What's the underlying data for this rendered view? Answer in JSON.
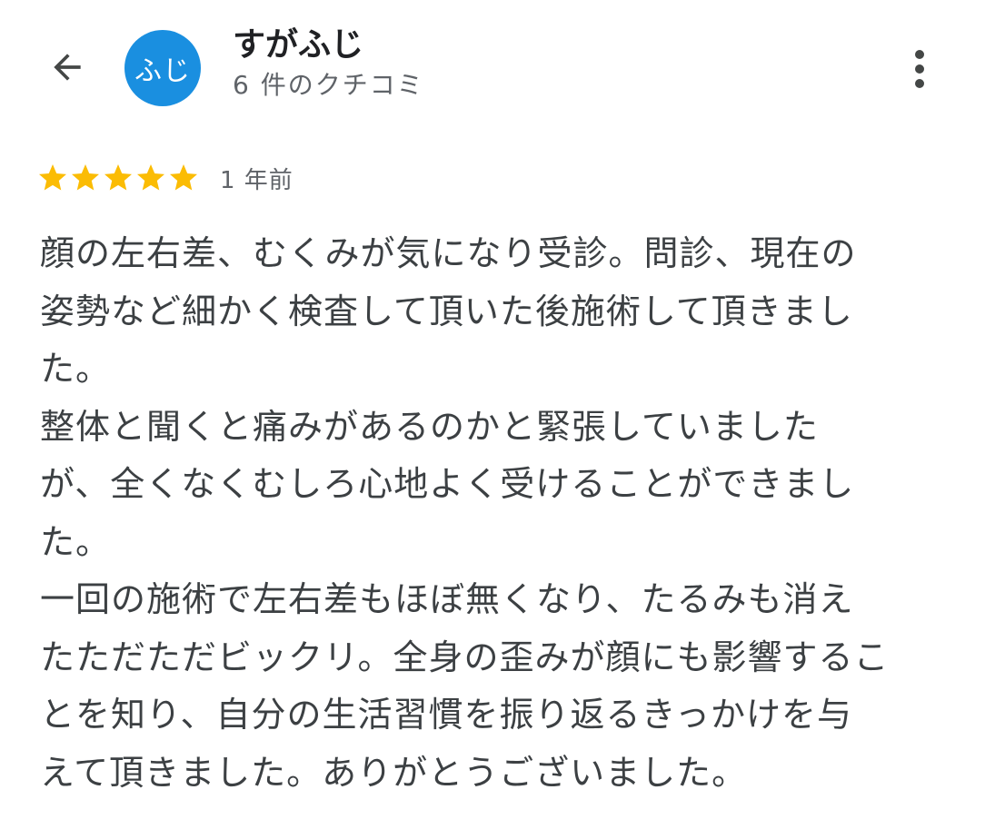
{
  "header": {
    "back_icon": "arrow-back-icon",
    "avatar_text": "ふじ",
    "avatar_color": "#1a8fe0",
    "reviewer_name": "すがふじ",
    "review_count": "6 件のクチコミ",
    "more_icon": "more-vert-icon"
  },
  "review": {
    "rating": 5,
    "rating_max": 5,
    "star_color": "#fbbc04",
    "date": "1 年前",
    "lines": [
      "顔の左右差、むくみが気になり受診。問診、現在の",
      "姿勢など細かく検査して頂いた後施術して頂きまし",
      "た。",
      "整体と聞くと痛みがあるのかと緊張していました",
      "が、全くなくむしろ心地よく受けることができまし",
      "た。",
      "一回の施術で左右差もほぼ無くなり、たるみも消え",
      "たただただビックリ。全身の歪みが顔にも影響するこ",
      "とを知り、自分の生活習慣を振り返るきっかけを与",
      "えて頂きました。ありがとうございました。"
    ]
  }
}
